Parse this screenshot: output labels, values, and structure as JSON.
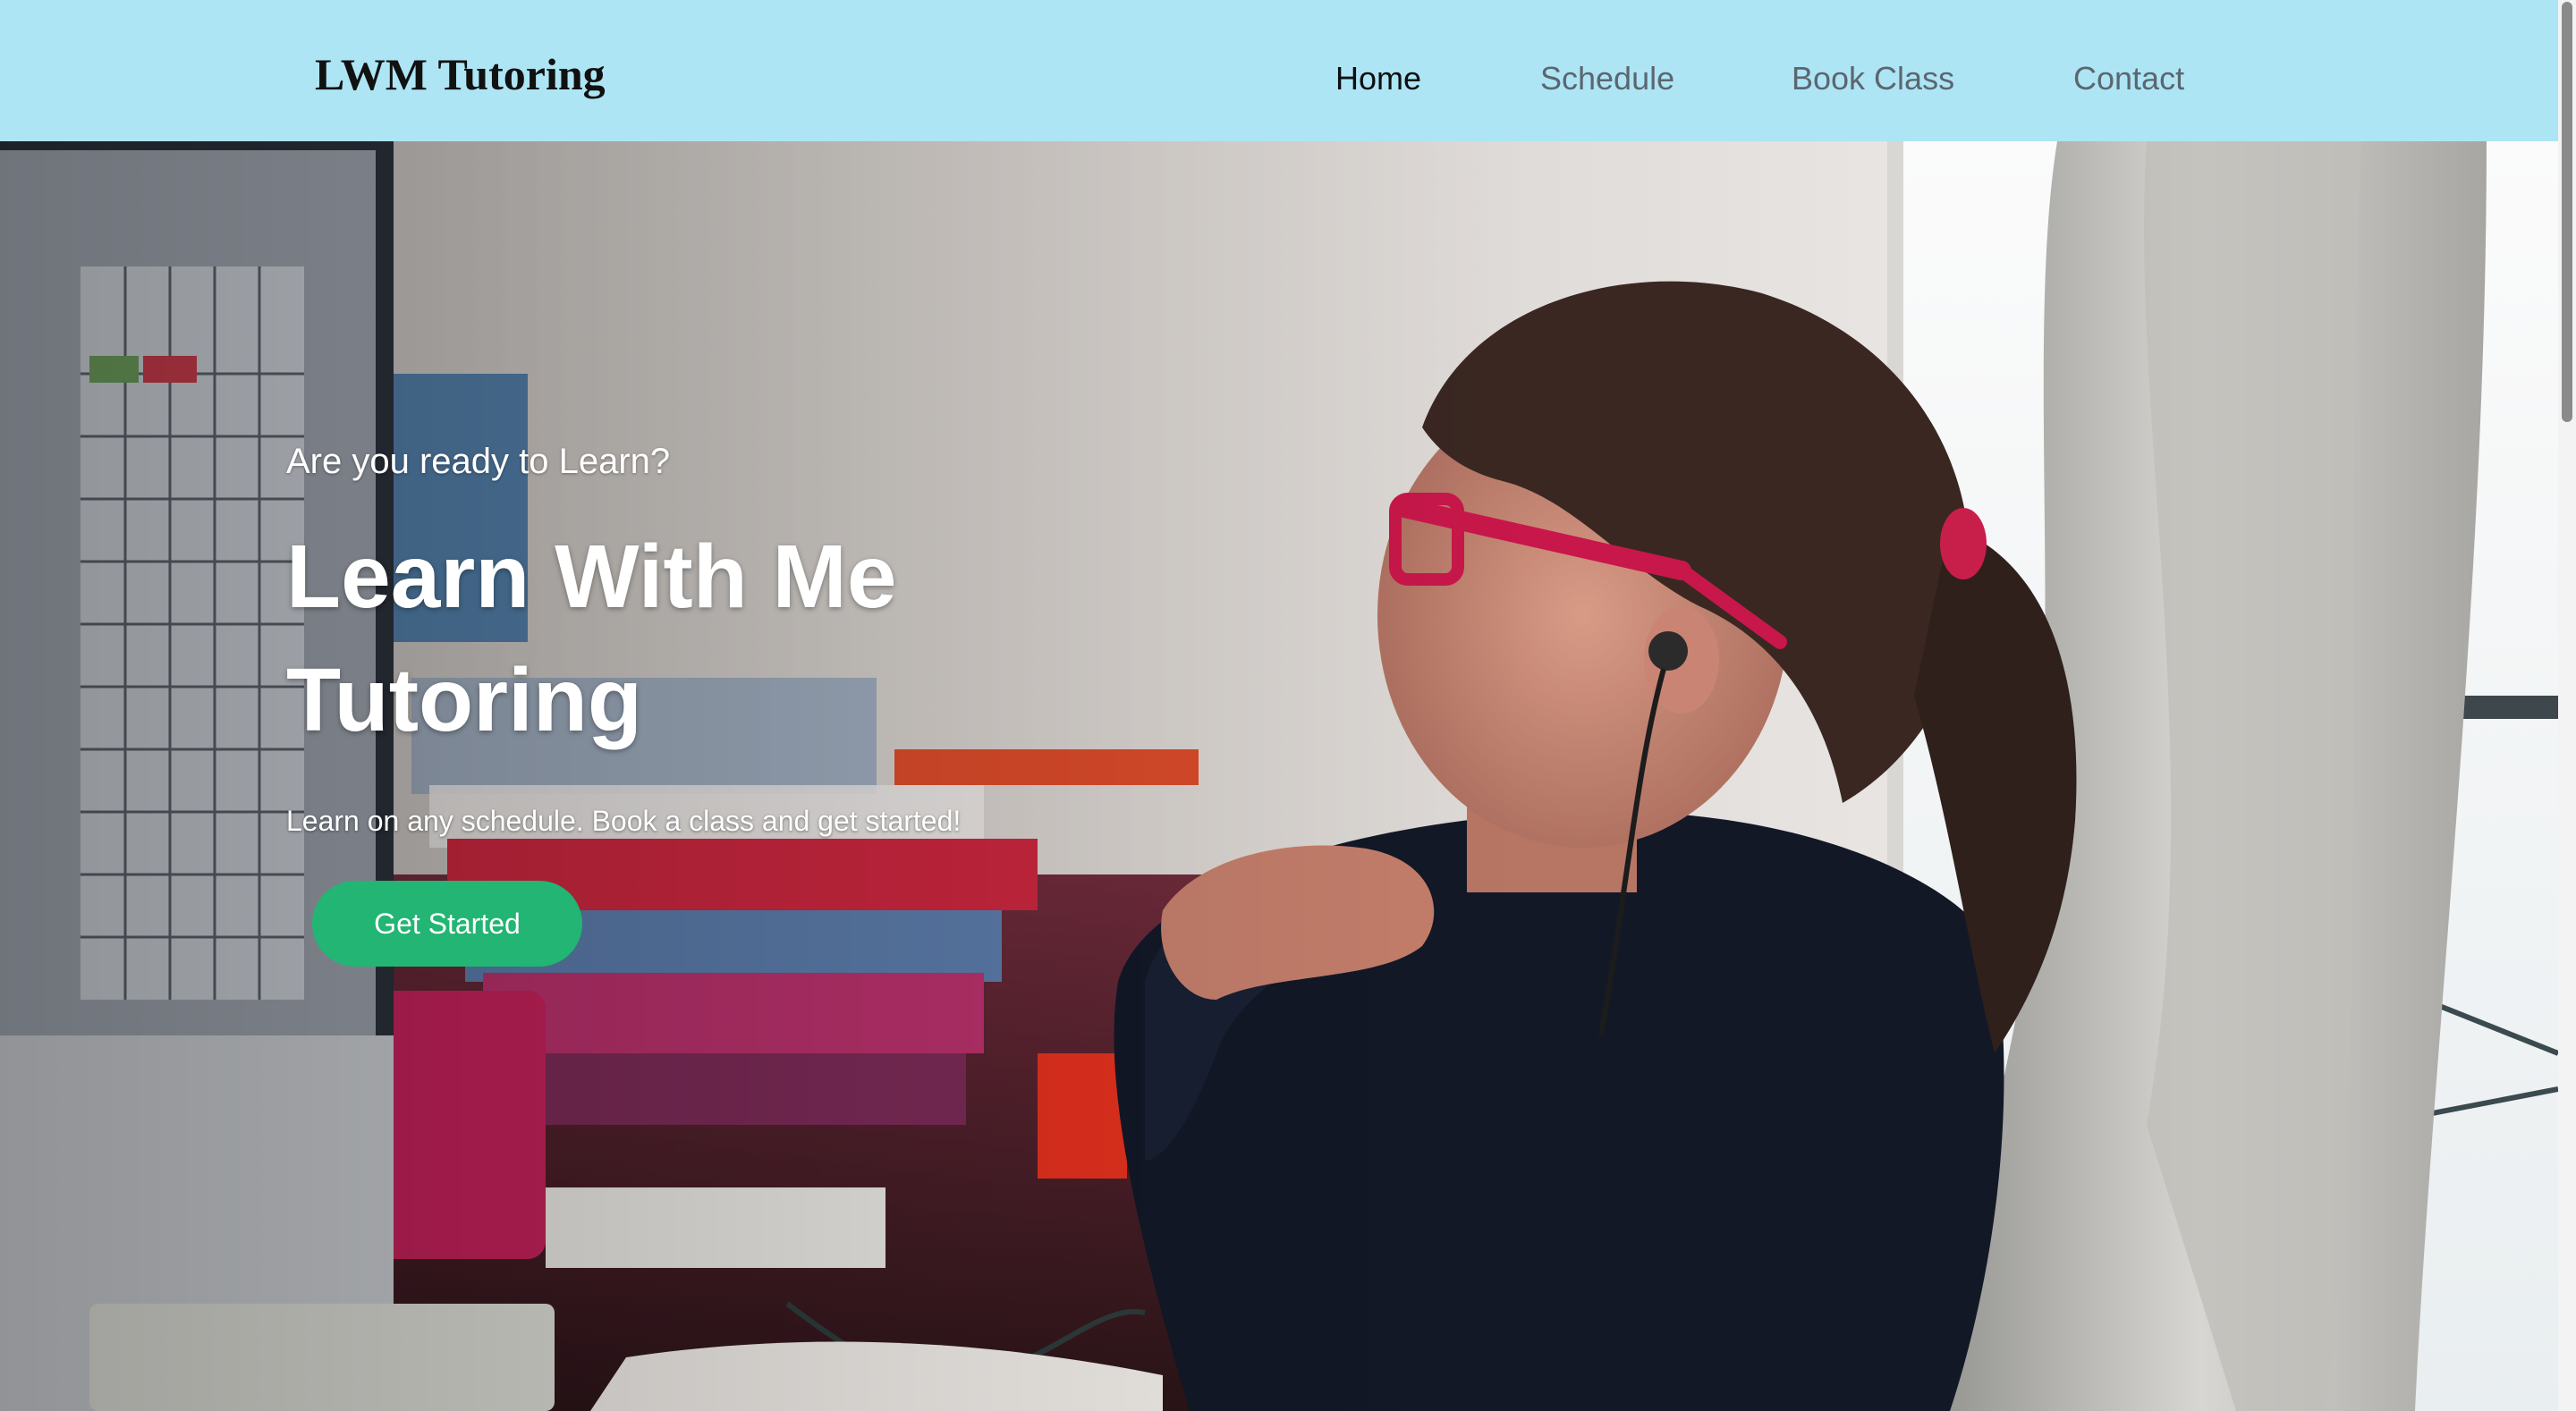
{
  "brand": {
    "name": "LWM Tutoring"
  },
  "nav": {
    "items": [
      {
        "label": "Home",
        "active": true
      },
      {
        "label": "Schedule",
        "active": false
      },
      {
        "label": "Book Class",
        "active": false
      },
      {
        "label": "Contact",
        "active": false
      }
    ]
  },
  "hero": {
    "eyebrow": "Are you ready to Learn?",
    "title_line1": "Learn With Me",
    "title_line2": "Tutoring",
    "subtitle": "Learn on any schedule. Book a class and get started!",
    "cta_label": "Get Started",
    "image": "girl-at-computer-photo"
  },
  "colors": {
    "navbar_bg": "#ade5f4",
    "cta_bg": "#22b573",
    "nav_active": "#0e0f12",
    "nav_inactive": "#5b6670"
  }
}
